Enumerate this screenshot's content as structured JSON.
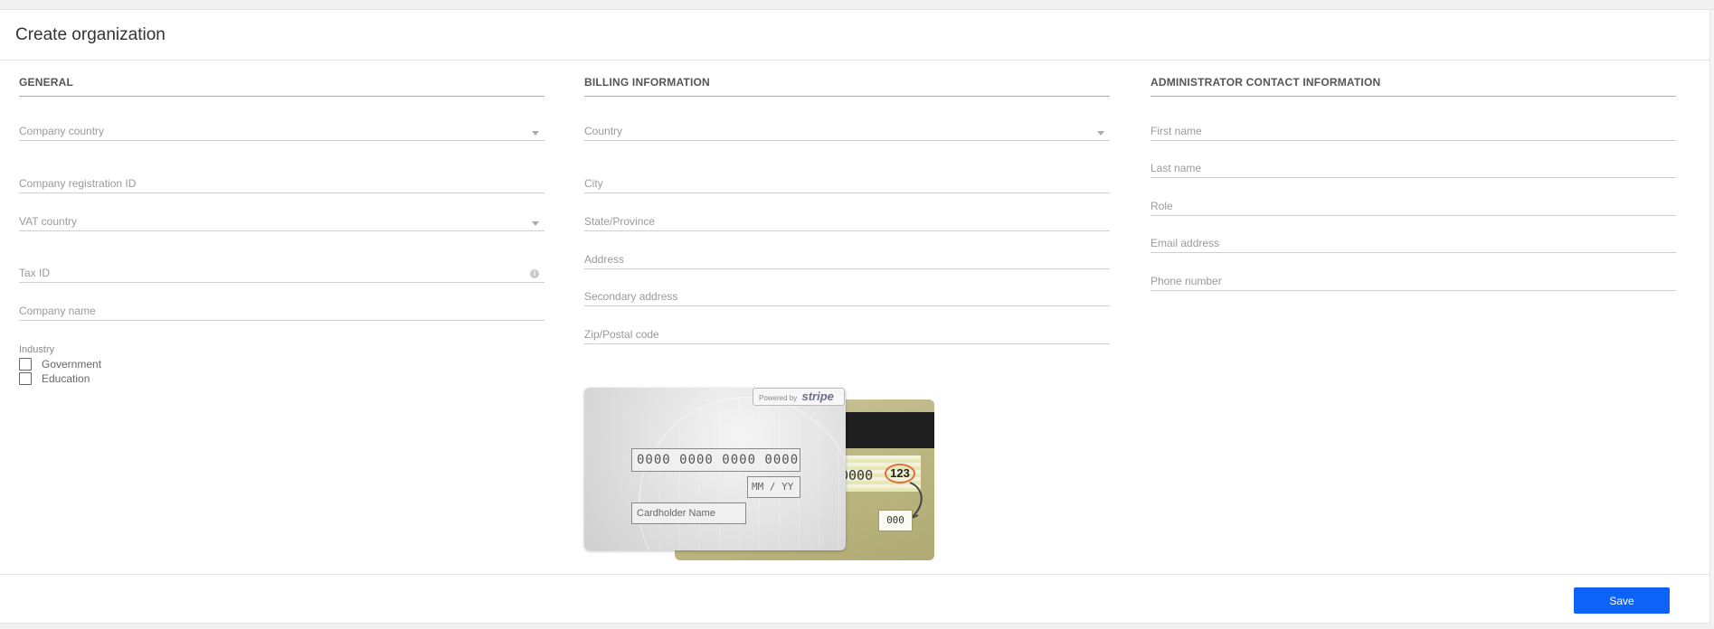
{
  "header": {
    "title": "Create organization"
  },
  "general": {
    "section_title": "GENERAL",
    "company_country": {
      "placeholder": "Company country"
    },
    "company_registration_id": {
      "placeholder": "Company registration ID"
    },
    "vat_country": {
      "placeholder": "VAT country"
    },
    "tax_id": {
      "placeholder": "Tax ID",
      "info_icon": "i"
    },
    "company_name": {
      "placeholder": "Company name"
    },
    "industry": {
      "label": "Industry",
      "options": [
        {
          "label": "Government",
          "checked": false
        },
        {
          "label": "Education",
          "checked": false
        }
      ]
    }
  },
  "billing": {
    "section_title": "BILLING INFORMATION",
    "country": {
      "placeholder": "Country"
    },
    "city": {
      "placeholder": "City"
    },
    "state": {
      "placeholder": "State/Province"
    },
    "address": {
      "placeholder": "Address"
    },
    "secondary_address": {
      "placeholder": "Secondary address"
    },
    "zip": {
      "placeholder": "Zip/Postal code"
    },
    "card": {
      "powered_by": "Powered by",
      "brand": "stripe",
      "number": "0000 0000 0000 0000",
      "expiry": "MM / YY",
      "holder": "Cardholder Name",
      "back_number": "0000",
      "cvc_sample": "123",
      "cvc_box": "000"
    }
  },
  "admin": {
    "section_title": "ADMINISTRATOR CONTACT INFORMATION",
    "first_name": {
      "placeholder": "First name"
    },
    "last_name": {
      "placeholder": "Last name"
    },
    "role": {
      "placeholder": "Role"
    },
    "email": {
      "placeholder": "Email address"
    },
    "phone": {
      "placeholder": "Phone number"
    }
  },
  "footer": {
    "save_label": "Save"
  },
  "colors": {
    "accent": "#0d63f8",
    "divider": "#cfcfcf",
    "placeholder": "#9a9a9a"
  }
}
